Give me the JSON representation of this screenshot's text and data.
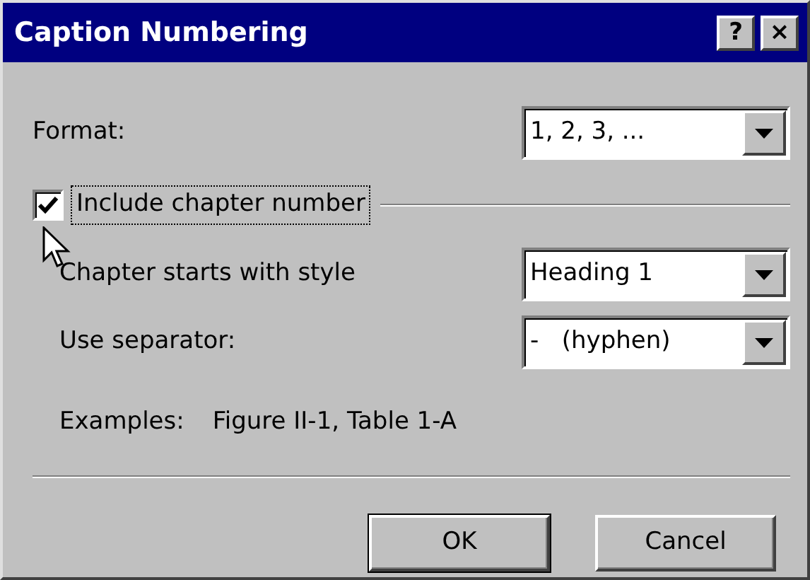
{
  "window": {
    "title": "Caption Numbering",
    "help_button": "?",
    "close_button": "×"
  },
  "format": {
    "label": "Format:",
    "value": "1, 2, 3, ..."
  },
  "include_chapter": {
    "label": "Include chapter number",
    "checked": true,
    "focused": true
  },
  "chapter_style": {
    "label": "Chapter starts with style",
    "value": "Heading 1"
  },
  "separator": {
    "label": "Use separator:",
    "value": "-   (hyphen)"
  },
  "examples": {
    "label": "Examples:",
    "value": "Figure II-1, Table 1-A"
  },
  "buttons": [
    {
      "label": "OK"
    },
    {
      "label": "Cancel"
    }
  ]
}
